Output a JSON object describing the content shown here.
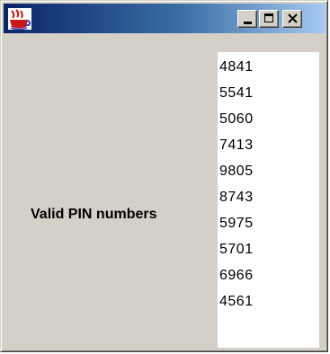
{
  "window": {
    "title": "",
    "icon": "java-coffee-cup-icon",
    "titlebar_gradient": [
      "#0a246a",
      "#a6caf0"
    ],
    "controls": {
      "minimize": "minimize-icon",
      "maximize": "maximize-icon",
      "close": "close-icon"
    }
  },
  "main": {
    "label": "Valid PIN numbers",
    "pins": [
      "4841",
      "5541",
      "5060",
      "7413",
      "9805",
      "8743",
      "5975",
      "5701",
      "6966",
      "4561"
    ]
  }
}
